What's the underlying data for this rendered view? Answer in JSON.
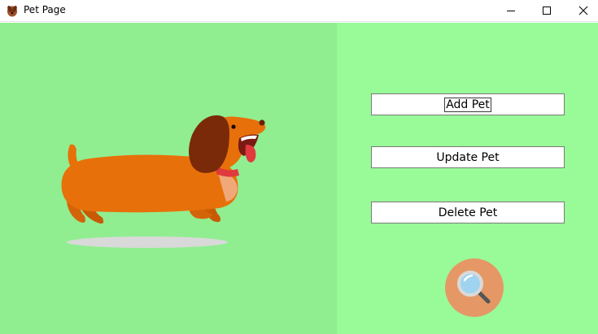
{
  "window": {
    "title": "Pet Page",
    "app_icon": "pet-dog-icon",
    "controls": [
      "minimize-icon",
      "maximize-icon",
      "close-icon"
    ]
  },
  "illustration": {
    "subject": "cartoon dachshund running",
    "shadow_color": "#d9d9d9"
  },
  "actions": {
    "add_label": "Add Pet",
    "update_label": "Update Pet",
    "delete_label": "Delete Pet",
    "search_icon": "magnifier-icon"
  },
  "colors": {
    "left_background": "#90ee90",
    "right_background": "#98fb98",
    "search_button": "#e59866",
    "dog_body": "#e8700a",
    "dog_ear": "#7a2a08"
  }
}
